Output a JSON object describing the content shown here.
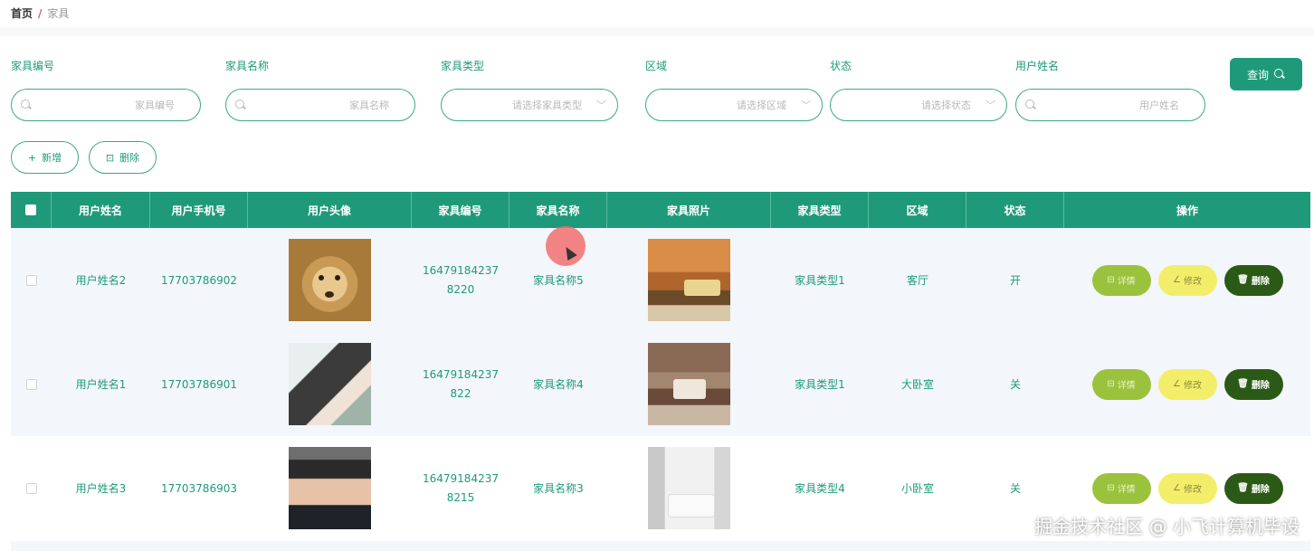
{
  "breadcrumb": {
    "home": "首页",
    "separator": "/",
    "current": "家具"
  },
  "search": {
    "fields": [
      {
        "label": "家具编号",
        "placeholder": "家具编号",
        "icon": "search-icon"
      },
      {
        "label": "家具名称",
        "placeholder": "家具名称",
        "icon": "search-icon"
      },
      {
        "label": "家具类型",
        "placeholder": "请选择家具类型",
        "icon": "chevron-down-icon"
      },
      {
        "label": "区域",
        "placeholder": "请选择区域",
        "icon": "chevron-down-icon"
      },
      {
        "label": "状态",
        "placeholder": "请选择状态",
        "icon": "chevron-down-icon"
      },
      {
        "label": "用户姓名",
        "placeholder": "用户姓名",
        "icon": "search-icon"
      }
    ],
    "query_label": "查询"
  },
  "actions": {
    "add_label": "新增",
    "add_icon": "+",
    "delete_label": "删除",
    "delete_icon": "⊡"
  },
  "table": {
    "headers": [
      "用户姓名",
      "用户手机号",
      "用户头像",
      "家具编号",
      "家具名称",
      "家具照片",
      "家具类型",
      "区域",
      "状态",
      "操作"
    ],
    "rows": [
      {
        "user_name": "用户姓名2",
        "phone": "17703786902",
        "avatar": "puppy-photo",
        "furniture_no": "164791842378220",
        "furniture_name": "家具名称5",
        "photo": "living-room-photo",
        "type": "家具类型1",
        "area": "客厅",
        "status": "开"
      },
      {
        "user_name": "用户姓名1",
        "phone": "17703786901",
        "avatar": "girl-illustration",
        "furniture_no": "16479184237822",
        "furniture_name": "家具名称4",
        "photo": "bedroom-photo",
        "type": "家具类型1",
        "area": "大卧室",
        "status": "关"
      },
      {
        "user_name": "用户姓名3",
        "phone": "17703786903",
        "avatar": "man-portrait",
        "furniture_no": "164791842378215",
        "furniture_name": "家具名称3",
        "photo": "white-room-photo",
        "type": "家具类型4",
        "area": "小卧室",
        "status": "关"
      }
    ],
    "row_actions": {
      "detail": "详情",
      "edit": "修改",
      "delete": "删除",
      "detail_icon": "⊟",
      "edit_icon": "∠",
      "delete_icon": "🗑"
    }
  },
  "colors": {
    "primary": "#1e9a7a",
    "detail_btn": "#9bc23c",
    "edit_btn": "#f3ee6a",
    "delete_btn": "#2b5a16"
  },
  "watermark": "掘金技术社区 @ 小飞计算机毕设"
}
